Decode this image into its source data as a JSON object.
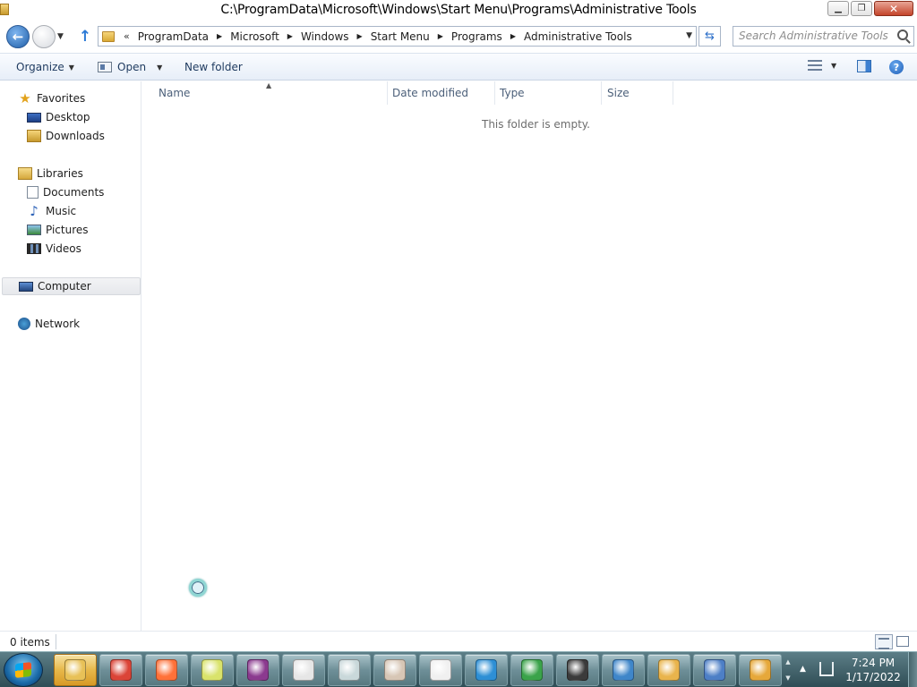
{
  "window": {
    "title": "C:\\ProgramData\\Microsoft\\Windows\\Start Menu\\Programs\\Administrative Tools",
    "minimize_icon": "minimize-icon",
    "maximize_icon": "restore-icon",
    "close_icon": "close-icon"
  },
  "address_bar": {
    "overflow": "«",
    "crumbs": [
      "ProgramData",
      "Microsoft",
      "Windows",
      "Start Menu",
      "Programs",
      "Administrative Tools"
    ]
  },
  "search": {
    "placeholder": "Search Administrative Tools"
  },
  "commands": {
    "organize": "Organize",
    "open": "Open",
    "new_folder": "New folder"
  },
  "nav_pane": {
    "favorites": "Favorites",
    "desktop": "Desktop",
    "downloads": "Downloads",
    "libraries": "Libraries",
    "documents": "Documents",
    "music": "Music",
    "pictures": "Pictures",
    "videos": "Videos",
    "computer": "Computer",
    "network": "Network"
  },
  "columns": {
    "name": "Name",
    "date_modified": "Date modified",
    "type": "Type",
    "size": "Size"
  },
  "content": {
    "empty_message": "This folder is empty."
  },
  "status": {
    "item_count": "0 items"
  },
  "taskbar": {
    "time": "7:24 PM",
    "date": "1/17/2022",
    "apps": [
      {
        "name": "windows-explorer-icon",
        "color": "#e8c157"
      },
      {
        "name": "chrome-icon",
        "color": "#db4437"
      },
      {
        "name": "firefox-icon",
        "color": "#ff7139"
      },
      {
        "name": "sticky-notes-icon",
        "color": "#d9e36b"
      },
      {
        "name": "winrar-icon",
        "color": "#8b3a8f"
      },
      {
        "name": "xps-viewer-icon",
        "color": "#e6e6e6"
      },
      {
        "name": "performance-monitor-icon",
        "color": "#c9d8da"
      },
      {
        "name": "resource-monitor-icon",
        "color": "#d7c6b5"
      },
      {
        "name": "clock-icon",
        "color": "#f0f0f0"
      },
      {
        "name": "windows-update-icon",
        "color": "#2d8fd5"
      },
      {
        "name": "backup-restore-icon",
        "color": "#3aa34a"
      },
      {
        "name": "microphone-icon",
        "color": "#3b3b3b"
      },
      {
        "name": "remote-desktop-icon",
        "color": "#3f86c9"
      },
      {
        "name": "paint-icon",
        "color": "#e9b44c"
      },
      {
        "name": "task-manager-icon",
        "color": "#4d7fc6"
      },
      {
        "name": "scanner-icon",
        "color": "#e6a83a"
      }
    ]
  }
}
